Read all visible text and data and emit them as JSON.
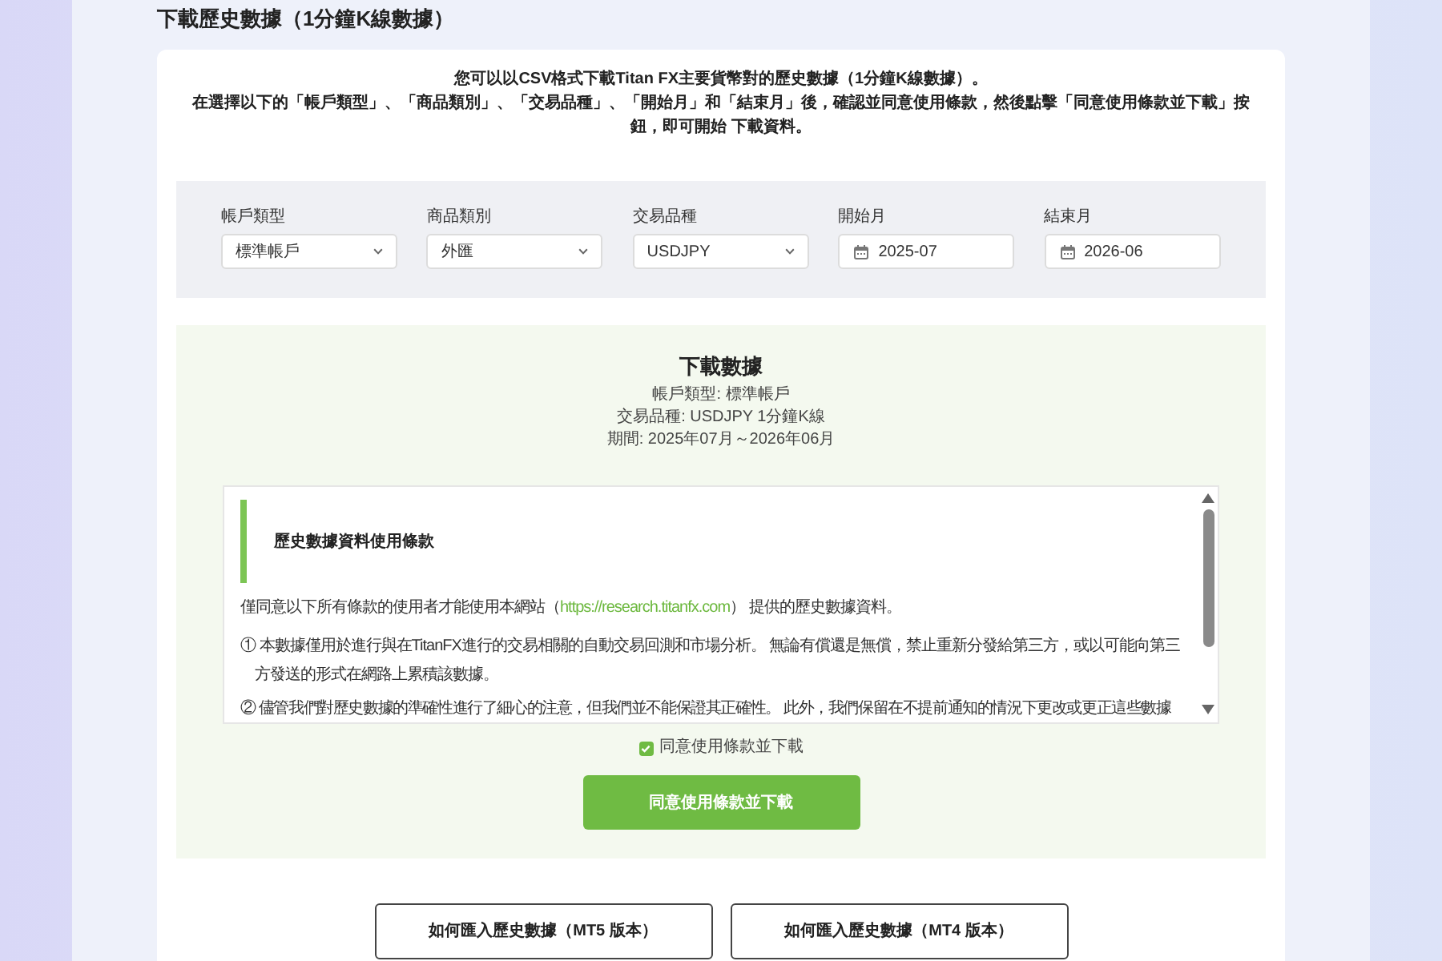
{
  "page_title": "下載歷史數據（1分鐘K線數據）",
  "intro": {
    "lines": [
      "您可以以CSV格式下載Titan FX主要貨幣對的歷史數據（1分鐘K線數據）。",
      "在選擇以下的「帳戶類型」、「商品類別」、「交易品種」、「開始月」和「結束月」後，確認並同意使用條款，然後點擊「同意使用條款並下載」按鈕，即可開始 下載資料。"
    ]
  },
  "filters": [
    {
      "kind": "select",
      "label": "帳戶類型",
      "value": "標準帳戶"
    },
    {
      "kind": "select",
      "label": "商品類別",
      "value": "外匯"
    },
    {
      "kind": "select",
      "label": "交易品種",
      "value": "USDJPY"
    },
    {
      "kind": "month",
      "label": "開始月",
      "value": "2025-07"
    },
    {
      "kind": "month",
      "label": "結束月",
      "value": "2026-06"
    }
  ],
  "summary": {
    "title": "下載數據",
    "lines": [
      "帳戶類型: 標準帳戶",
      "交易品種: USDJPY 1分鐘K線",
      "期間: 2025年07月～2026年06月"
    ]
  },
  "terms": {
    "heading": "歷史數據資料使用條款",
    "paragraphs": [
      {
        "kind": "link_sentence",
        "before": "僅同意以下所有條款的使用者才能使用本網站（",
        "link": "https://research.titanfx.com",
        "after": "） 提供的歷史數據資料。"
      },
      {
        "kind": "numbered",
        "text": "① 本數據僅用於進行與在TitanFX進行的交易相關的自動交易回測和市場分析。 無論有償還是無償，禁止重新分發給第三方，或以可能向第三方發送的形式在網路上累積該數據。"
      },
      {
        "kind": "numbered_cut",
        "text": "② 儘管我們對歷史數據的準確性進行了細心的注意，但我們並不能保證其正確性。 此外，我們保留在不提前通知的情況下更改或更正這些數據"
      }
    ]
  },
  "agree": {
    "label": "同意使用條款並下載",
    "checked": true
  },
  "download_button": {
    "label": "同意使用條款並下載"
  },
  "guide_buttons": [
    {
      "label": "如何匯入歷史數據（MT5 版本）"
    },
    {
      "label": "如何匯入歷史數據（MT4 版本）"
    }
  ]
}
